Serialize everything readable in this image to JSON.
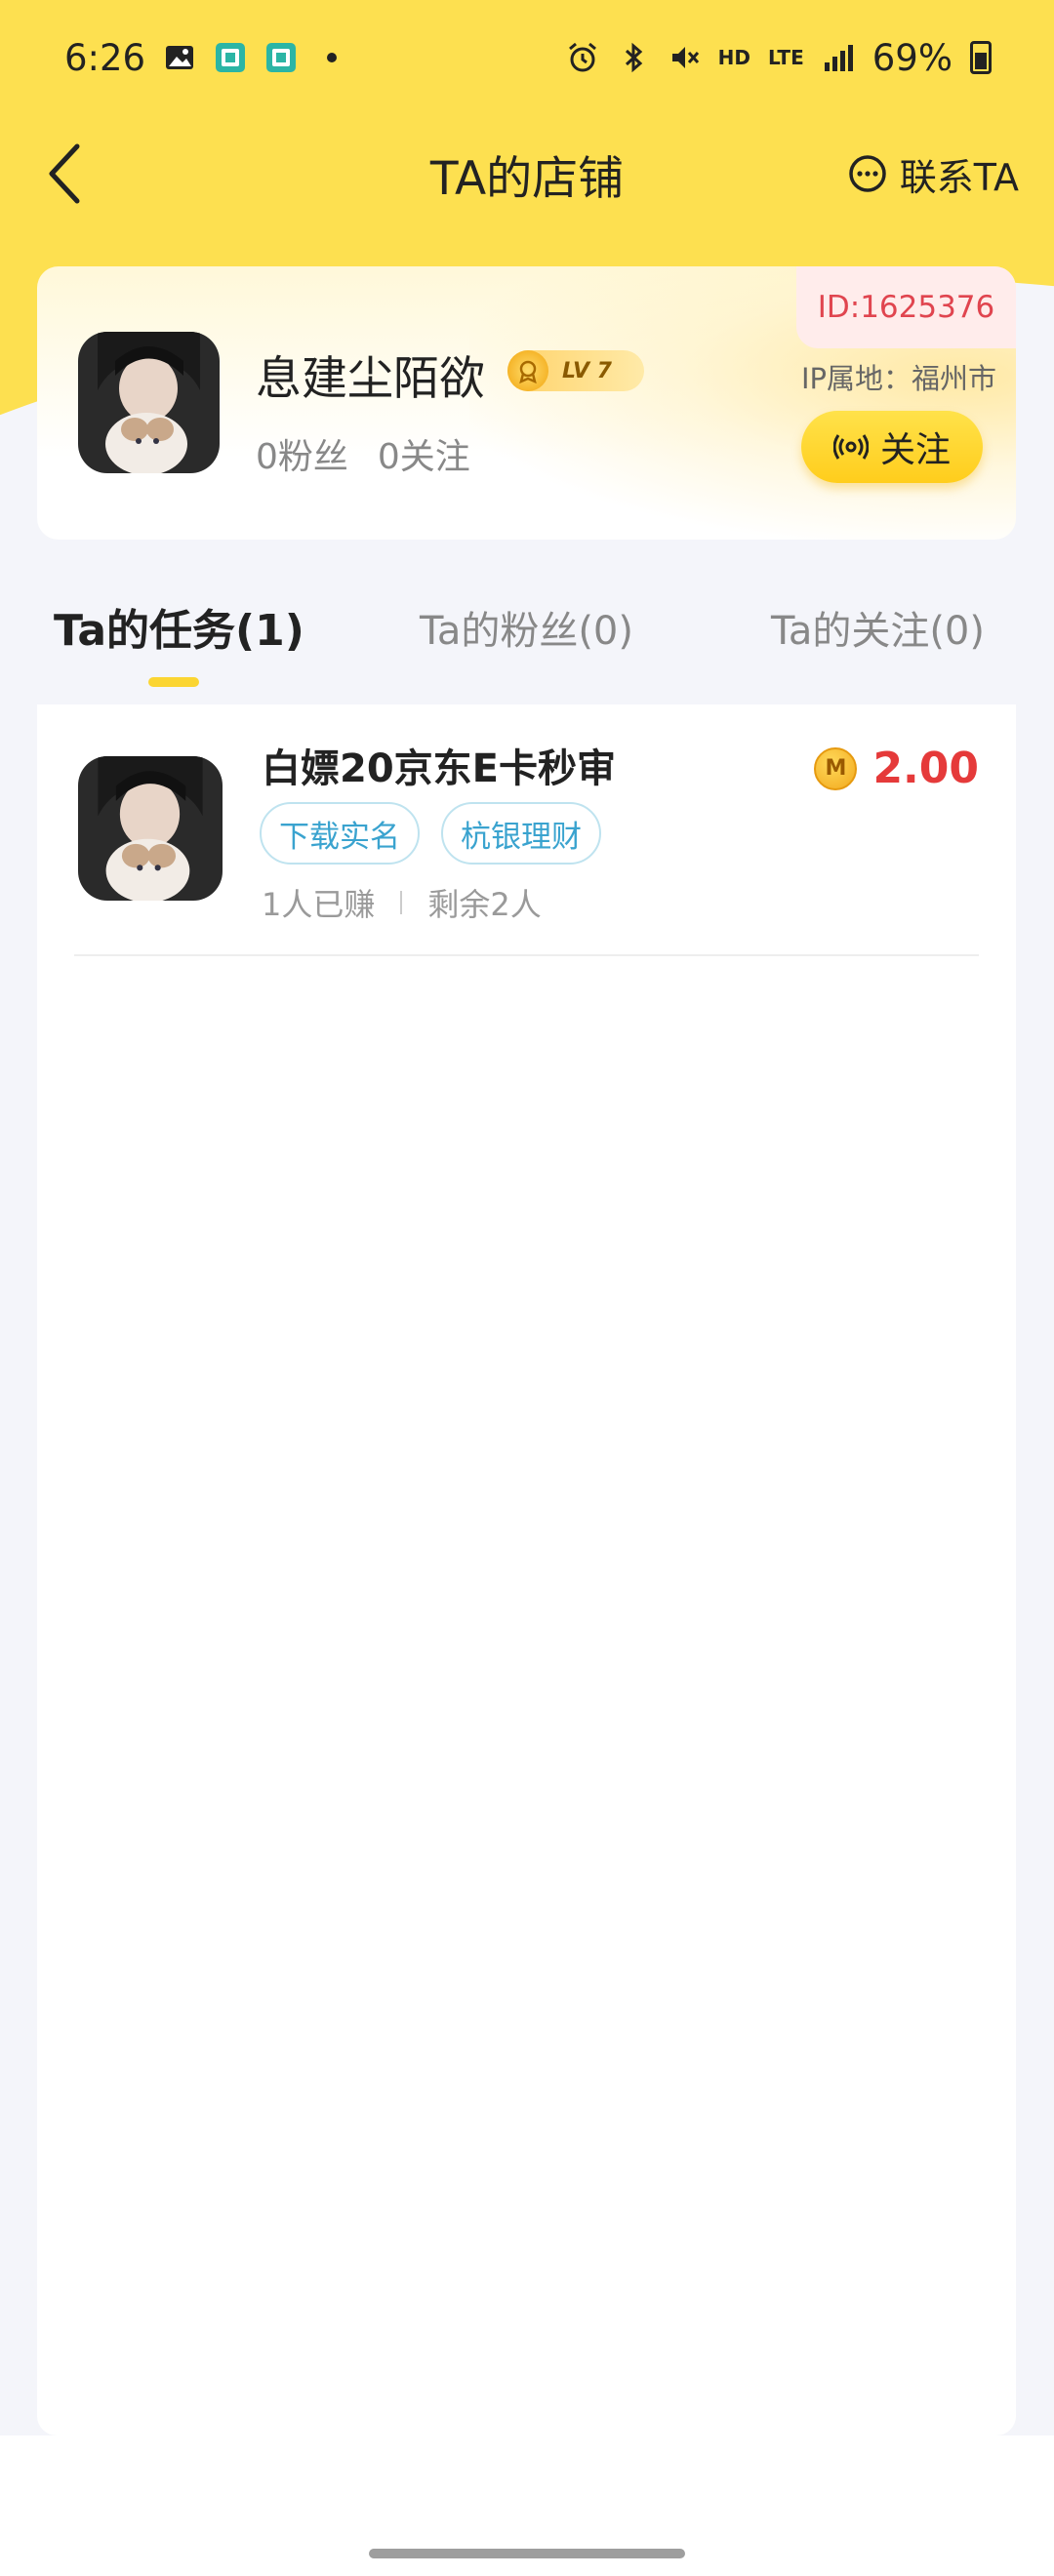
{
  "status_bar": {
    "time": "6:26",
    "network": "HD",
    "lte": "LTE",
    "battery": "69%"
  },
  "nav": {
    "title": "TA的店铺",
    "contact_label": "联系TA"
  },
  "profile": {
    "name": "息建尘陌欲",
    "level": "LV 7",
    "fans": "0粉丝",
    "following": "0关注",
    "id": "ID:1625376",
    "ip_location": "IP属地：福州市",
    "follow_label": "关注"
  },
  "tabs": [
    {
      "label": "Ta的任务(1)",
      "active": true
    },
    {
      "label": "Ta的粉丝(0)",
      "active": false
    },
    {
      "label": "Ta的关注(0)",
      "active": false
    }
  ],
  "tasks": [
    {
      "title": "白嫖20京东E卡秒审",
      "tags": [
        "下载实名",
        "杭银理财"
      ],
      "earned": "1人已赚",
      "remaining": "剩余2人",
      "coin_label": "M",
      "price": "2.00"
    }
  ],
  "colors": {
    "brand_yellow": "#fde050",
    "price_red": "#e53a3a",
    "tag_blue": "#3aa3cf",
    "id_red": "#e0454f"
  }
}
